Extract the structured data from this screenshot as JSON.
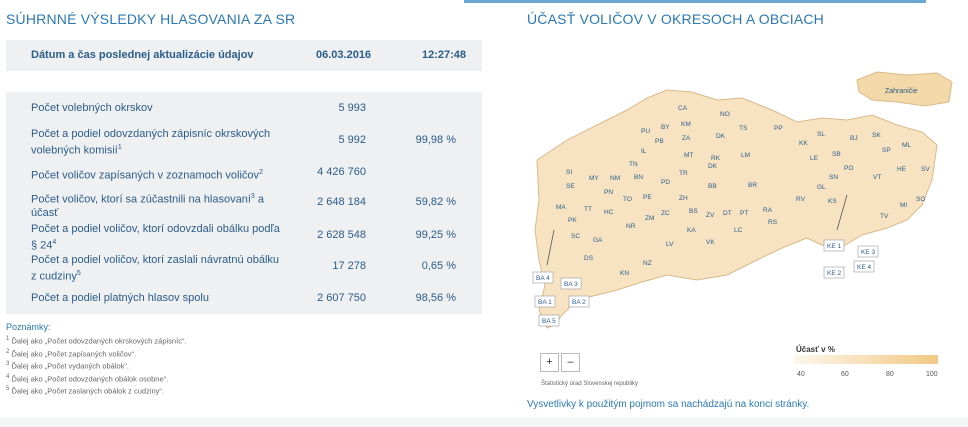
{
  "left_title": "SÚHRNNÉ VÝSLEDKY HLASOVANIA ZA SR",
  "right_title": "ÚČASŤ VOLIČOV V OKRESOCH A OBCIACH",
  "update": {
    "label": "Dátum a čas poslednej aktualizácie údajov",
    "date": "06.03.2016",
    "time": "12:27:48"
  },
  "rows": [
    {
      "label": "Počet volebných okrskov",
      "sup": "",
      "v1": "5 993",
      "v2": ""
    },
    {
      "label": "Počet a podiel odovzdaných zápisníc okrskových volebných komisií",
      "sup": "1",
      "v1": "5 992",
      "v2": "99,98 %"
    },
    {
      "label": "Počet voličov zapísaných v zoznamoch voličov",
      "sup": "2",
      "v1": "4 426 760",
      "v2": ""
    },
    {
      "label": "Počet voličov, ktorí sa zúčastnili na hlasovaní",
      "sup": "3",
      "tail": " a účasť",
      "v1": "2 648 184",
      "v2": "59,82 %"
    },
    {
      "label": "Počet a podiel voličov, ktorí odovzdali obálku podľa § 24",
      "sup": "4",
      "v1": "2 628 548",
      "v2": "99,25 %"
    },
    {
      "label": "Počet a podiel voličov, ktorí zaslali návratnú obálku z cudziny",
      "sup": "5",
      "v1": "17 278",
      "v2": "0,65 %"
    },
    {
      "label": "Počet a podiel platných hlasov spolu",
      "sup": "",
      "v1": "2 607 750",
      "v2": "98,56 %"
    }
  ],
  "notes_title": "Poznámky:",
  "notes": [
    {
      "n": "1",
      "t": "Ďalej ako „Počet odovzdaných okrskových zápisníc“."
    },
    {
      "n": "2",
      "t": "Ďalej ako „Počet zapísaných voličov“."
    },
    {
      "n": "3",
      "t": "Ďalej ako „Počet vydaných obálok“."
    },
    {
      "n": "4",
      "t": "Ďalej ako „Počet odovzdaných obálok osobne“."
    },
    {
      "n": "5",
      "t": "Ďalej ako „Počet zaslaných obálok z cudziny“."
    }
  ],
  "map": {
    "abroad_label": "Zahraničie",
    "districts": [
      "CA",
      "NO",
      "BY",
      "KM",
      "DK",
      "TS",
      "PU",
      "PB",
      "ZA",
      "PP",
      "KK",
      "SL",
      "BJ",
      "SK",
      "ML",
      "IL",
      "MT",
      "RK",
      "LM",
      "LE",
      "SB",
      "SP",
      "HE",
      "SV",
      "TN",
      "SI",
      "MY",
      "NM",
      "BN",
      "PD",
      "TR",
      "SE",
      "PE",
      "BB",
      "BR",
      "SN",
      "GL",
      "PO",
      "VT",
      "PN",
      "TO",
      "ZH",
      "RV",
      "KS",
      "MI",
      "SO",
      "MA",
      "TT",
      "HC",
      "ZC",
      "BS",
      "DT",
      "PT",
      "RA",
      "TV",
      "PK",
      "NR",
      "ZM",
      "ZV",
      "DK",
      "KA",
      "LC",
      "RS",
      "SC",
      "GA",
      "LV",
      "VK",
      "DS",
      "NZ",
      "KN",
      "BA 4",
      "BA 3",
      "BA 1",
      "BA 2",
      "BA 5",
      "KE 1",
      "KE 3",
      "KE 4",
      "KE 2"
    ],
    "zoom_in": "+",
    "zoom_out": "–"
  },
  "legend": {
    "title": "Účasť v %",
    "ticks": [
      "40",
      "60",
      "80",
      "100"
    ]
  },
  "source": "Štatistický úrad Slovenskej republiky",
  "hint": "Vysvetlivky k použitým pojmom sa nachádzajú na konci stránky."
}
